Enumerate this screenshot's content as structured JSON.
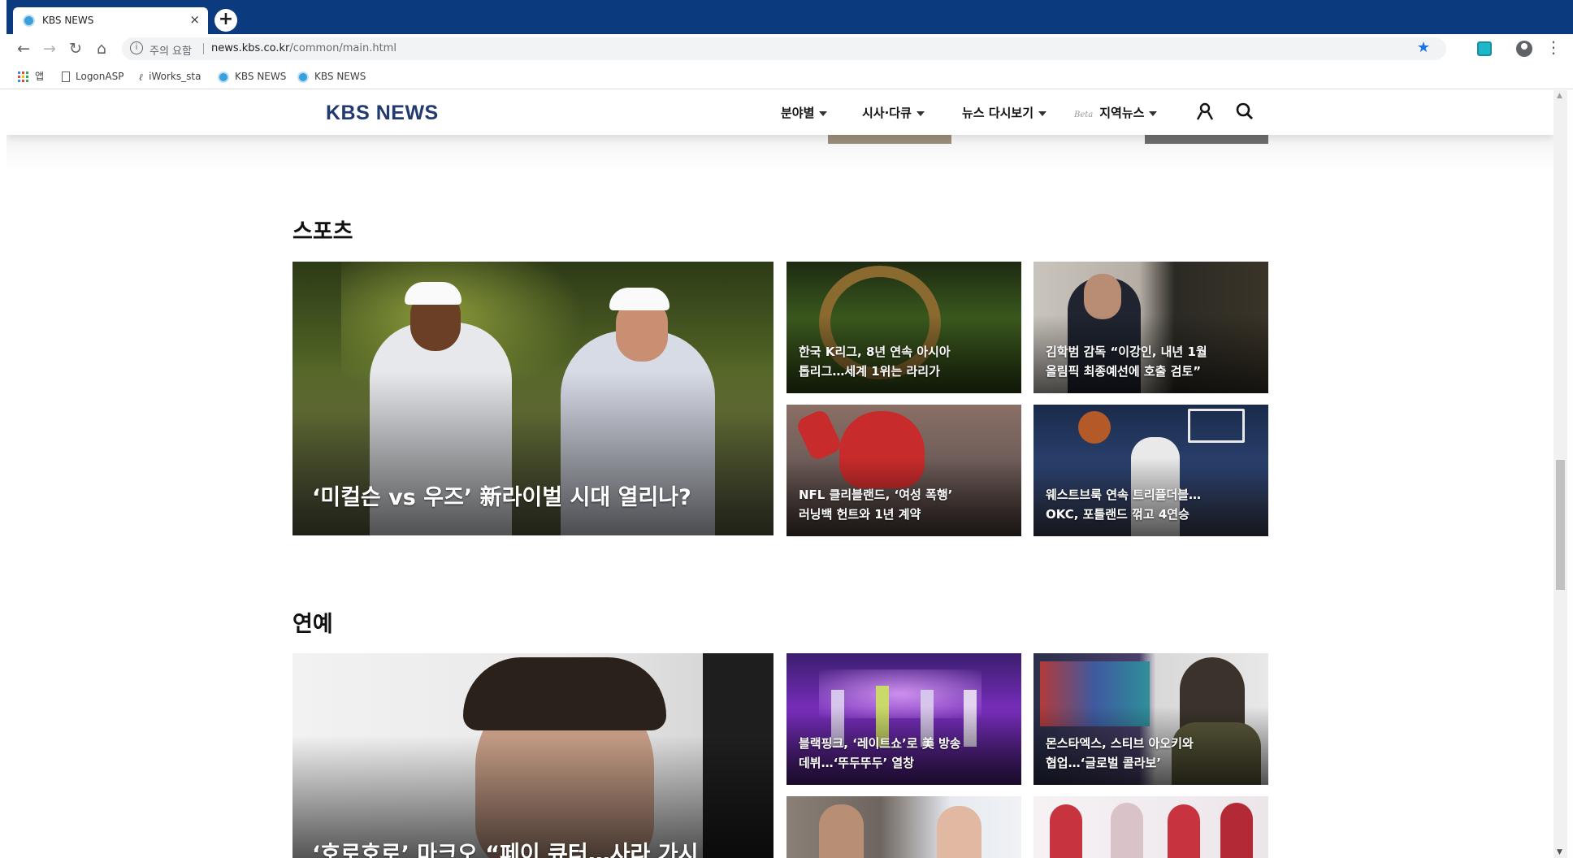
{
  "browser": {
    "tab_title": "KBS NEWS",
    "tab_close": "×",
    "new_tab": "+",
    "nav": {
      "back": "←",
      "forward": "→",
      "reload": "↻",
      "home": "⌂"
    },
    "omnibox": {
      "security_label": "주의 요함",
      "url_host": "news.kbs.co.kr",
      "url_path": "/common/main.html"
    },
    "star": "★",
    "menu": "⋮",
    "bookmarks": [
      {
        "label": "앱",
        "icon": "apps-icon"
      },
      {
        "label": "LogonASP",
        "icon": "page-icon"
      },
      {
        "label": "iWorks_sta",
        "icon": "ie-icon"
      },
      {
        "label": "KBS NEWS",
        "icon": "globe-icon"
      },
      {
        "label": "KBS NEWS",
        "icon": "globe-icon"
      }
    ]
  },
  "site": {
    "logo": "KBS NEWS",
    "nav": [
      {
        "label": "분야별"
      },
      {
        "label": "시사·다큐"
      },
      {
        "label": "뉴스 다시보기"
      },
      {
        "label": "지역뉴스",
        "badge": "Beta"
      }
    ],
    "icons": [
      "user-icon",
      "search-icon"
    ]
  },
  "sports": {
    "title": "스포츠",
    "featured": {
      "caption": "‘미컬슨 vs 우즈’ 新라이벌 시대 열리나?"
    },
    "items": [
      {
        "line1": "한국 K리그, 8년 연속 아시아",
        "line2": "톱리그…세계 1위는 라리가"
      },
      {
        "line1": "김학범 감독 “이강인, 내년 1월",
        "line2": "올림픽 최종예선에 호출 검토”"
      },
      {
        "line1": "NFL 클리블랜드, ‘여성 폭행’",
        "line2": "러닝백 헌트와 1년 계약"
      },
      {
        "line1": "웨스트브룩 연속 트리플더블…",
        "line2": "OKC, 포틀랜드 꺾고 4연승"
      }
    ]
  },
  "entertainment": {
    "title": "연예",
    "featured": {
      "caption": "‘호로호로’ 마크오 “페이 큐터…사라 가시"
    },
    "items": [
      {
        "line1": "블랙핑크, ‘레이트쇼’로 美 방송",
        "line2": "데뷔…‘뚜두뚜두’ 열창"
      },
      {
        "line1": "몬스타엑스, 스티브 아오키와",
        "line2": "협업…‘글로벌 콜라보’"
      }
    ]
  },
  "colors": {
    "chrome_tab_bar": "#0b3a7e",
    "logo": "#223a6e",
    "star": "#1a73e8"
  }
}
